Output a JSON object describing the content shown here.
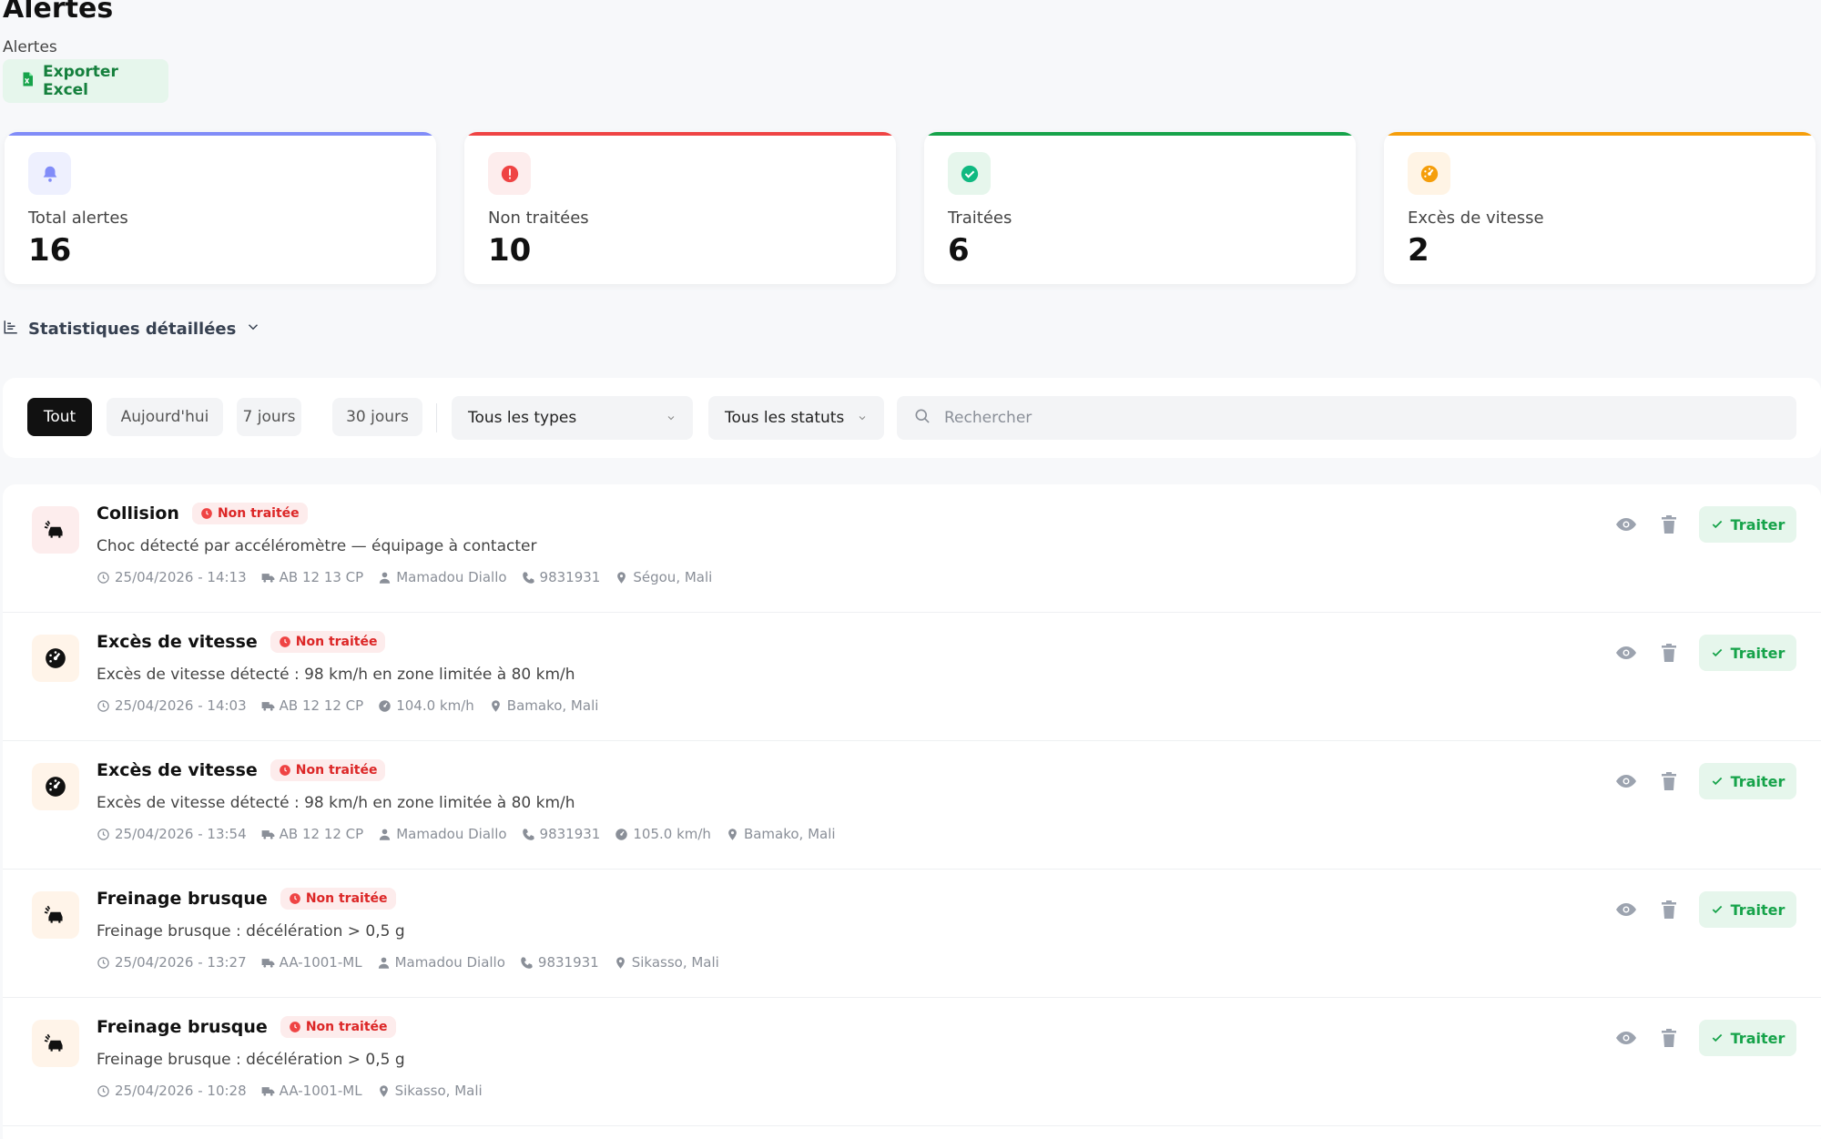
{
  "page": {
    "title": "Alertes",
    "breadcrumb": "Alertes",
    "export_label": "Exporter Excel"
  },
  "stats": [
    {
      "label": "Total alertes",
      "value": "16",
      "color": "#818cf8",
      "icon": "bell-icon"
    },
    {
      "label": "Non traitées",
      "value": "10",
      "color": "#ef4444",
      "icon": "alert-circle-icon"
    },
    {
      "label": "Traitées",
      "value": "6",
      "color": "#16a34a",
      "icon": "check-circle-icon"
    },
    {
      "label": "Excès de vitesse",
      "value": "2",
      "color": "#f59e0b",
      "icon": "speedometer-icon"
    }
  ],
  "stats_toggle": {
    "label": "Statistiques détaillées"
  },
  "filters": {
    "periods": [
      "Tout",
      "Aujourd'hui",
      "7 jours",
      "30 jours"
    ],
    "active_period": "Tout",
    "type_select": "Tous les types",
    "status_select": "Tous les statuts",
    "search_placeholder": "Rechercher"
  },
  "alerts": [
    {
      "kind": "collision",
      "title": "Collision",
      "status": "Non traitée",
      "description": "Choc détecté par accéléromètre — équipage à contacter",
      "datetime": "25/04/2026 - 14:13",
      "vehicle": "AB 12 13 CP",
      "driver": "Mamadou Diallo",
      "phone": "9831931",
      "speed": "",
      "location": "Ségou, Mali",
      "action_label": "Traiter"
    },
    {
      "kind": "speed",
      "title": "Excès de vitesse",
      "status": "Non traitée",
      "description": "Excès de vitesse détecté : 98 km/h en zone limitée à 80 km/h",
      "datetime": "25/04/2026 - 14:03",
      "vehicle": "AB 12 12 CP",
      "driver": "",
      "phone": "",
      "speed": "104.0 km/h",
      "location": "Bamako, Mali",
      "action_label": "Traiter"
    },
    {
      "kind": "speed",
      "title": "Excès de vitesse",
      "status": "Non traitée",
      "description": "Excès de vitesse détecté : 98 km/h en zone limitée à 80 km/h",
      "datetime": "25/04/2026 - 13:54",
      "vehicle": "AB 12 12 CP",
      "driver": "Mamadou Diallo",
      "phone": "9831931",
      "speed": "105.0 km/h",
      "location": "Bamako, Mali",
      "action_label": "Traiter"
    },
    {
      "kind": "braking",
      "title": "Freinage brusque",
      "status": "Non traitée",
      "description": "Freinage brusque : décélération > 0,5 g",
      "datetime": "25/04/2026 - 13:27",
      "vehicle": "AA-1001-ML",
      "driver": "Mamadou Diallo",
      "phone": "9831931",
      "speed": "",
      "location": "Sikasso, Mali",
      "action_label": "Traiter"
    },
    {
      "kind": "braking",
      "title": "Freinage brusque",
      "status": "Non traitée",
      "description": "Freinage brusque : décélération > 0,5 g",
      "datetime": "25/04/2026 - 10:28",
      "vehicle": "AA-1001-ML",
      "driver": "",
      "phone": "",
      "speed": "",
      "location": "Sikasso, Mali",
      "action_label": "Traiter"
    }
  ]
}
